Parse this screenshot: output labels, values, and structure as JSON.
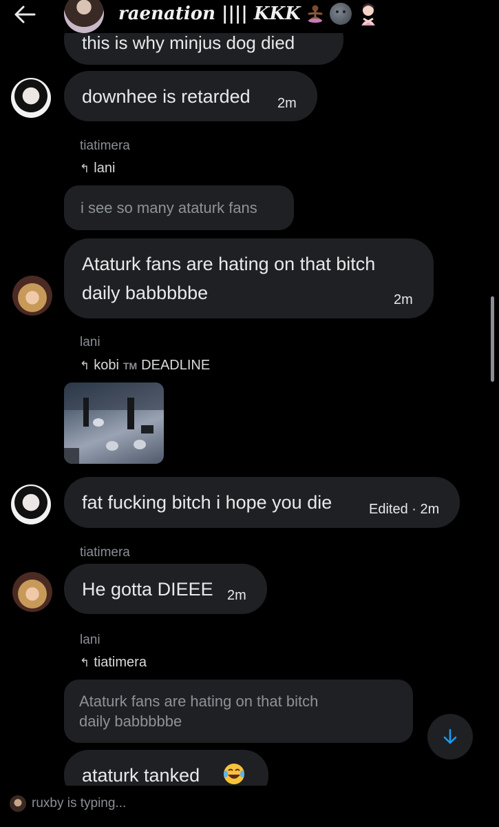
{
  "header": {
    "back_icon": "arrow-left-icon",
    "title": "raenation |||| KKK",
    "title_emojis": [
      "person-in-lotus-position-emoji",
      "new-moon-face-emoji",
      "person-gesturing-no-emoji"
    ]
  },
  "messages": {
    "cut_top": {
      "text": "this is why minjus dog died"
    },
    "m1": {
      "text": "downhee is retarded",
      "time": "2m"
    },
    "reply1": {
      "sender": "tiatimera",
      "reply_to": "lani",
      "quote": "i see so many ataturk fans"
    },
    "m2": {
      "line1": "Ataturk fans are hating on that bitch",
      "line2": "daily babbbbbe",
      "time": "2m"
    },
    "reply2": {
      "sender": "lani",
      "reply_to": "kobi",
      "reply_badge": "TM",
      "reply_suffix": "DEADLINE"
    },
    "m3": {
      "text": "fat fucking bitch i hope you die",
      "meta": "Edited · 2m"
    },
    "m4": {
      "sender": "tiatimera",
      "text": "He gotta DIEEE",
      "time": "2m"
    },
    "reply3": {
      "sender": "lani",
      "reply_to": "tiatimera",
      "quote_line1": "Ataturk fans are hating on that bitch",
      "quote_line2": "daily babbbbbe"
    },
    "m5": {
      "text": "ataturk tanked",
      "emoji": "face-with-tears-of-joy-emoji"
    }
  },
  "typing": {
    "text": "ruxby is typing..."
  },
  "scroll_down_icon": "arrow-down-icon",
  "colors": {
    "accent": "#1d9bf0",
    "bubble": "#1f2023",
    "background": "#000000",
    "muted": "#8b8f94"
  }
}
